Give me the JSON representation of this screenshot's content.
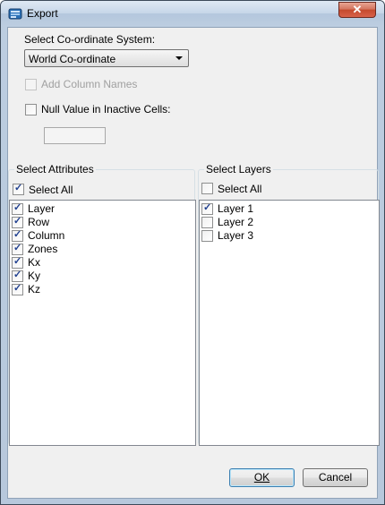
{
  "window": {
    "title": "Export",
    "close_symbol": "✕",
    "app_icon": "export-app-icon"
  },
  "coordinate": {
    "label": "Select Co-ordinate System:",
    "selected": "World Co-ordinate"
  },
  "options": {
    "add_column_names": {
      "label": "Add Column Names",
      "checked": false,
      "enabled": false
    },
    "null_value": {
      "label": "Null Value in Inactive Cells:",
      "checked": false
    },
    "null_value_input": ""
  },
  "attributes": {
    "title": "Select Attributes",
    "select_all_label": "Select All",
    "select_all_checked": true,
    "items": [
      {
        "label": "Layer",
        "checked": true
      },
      {
        "label": "Row",
        "checked": true
      },
      {
        "label": "Column",
        "checked": true
      },
      {
        "label": "Zones",
        "checked": true
      },
      {
        "label": "Kx",
        "checked": true
      },
      {
        "label": "Ky",
        "checked": true
      },
      {
        "label": "Kz",
        "checked": true
      }
    ]
  },
  "layers": {
    "title": "Select Layers",
    "select_all_label": "Select All",
    "select_all_checked": false,
    "items": [
      {
        "label": "Layer 1",
        "checked": true
      },
      {
        "label": "Layer 2",
        "checked": false
      },
      {
        "label": "Layer 3",
        "checked": false
      }
    ]
  },
  "buttons": {
    "ok_label": "OK",
    "cancel_label": "Cancel"
  }
}
